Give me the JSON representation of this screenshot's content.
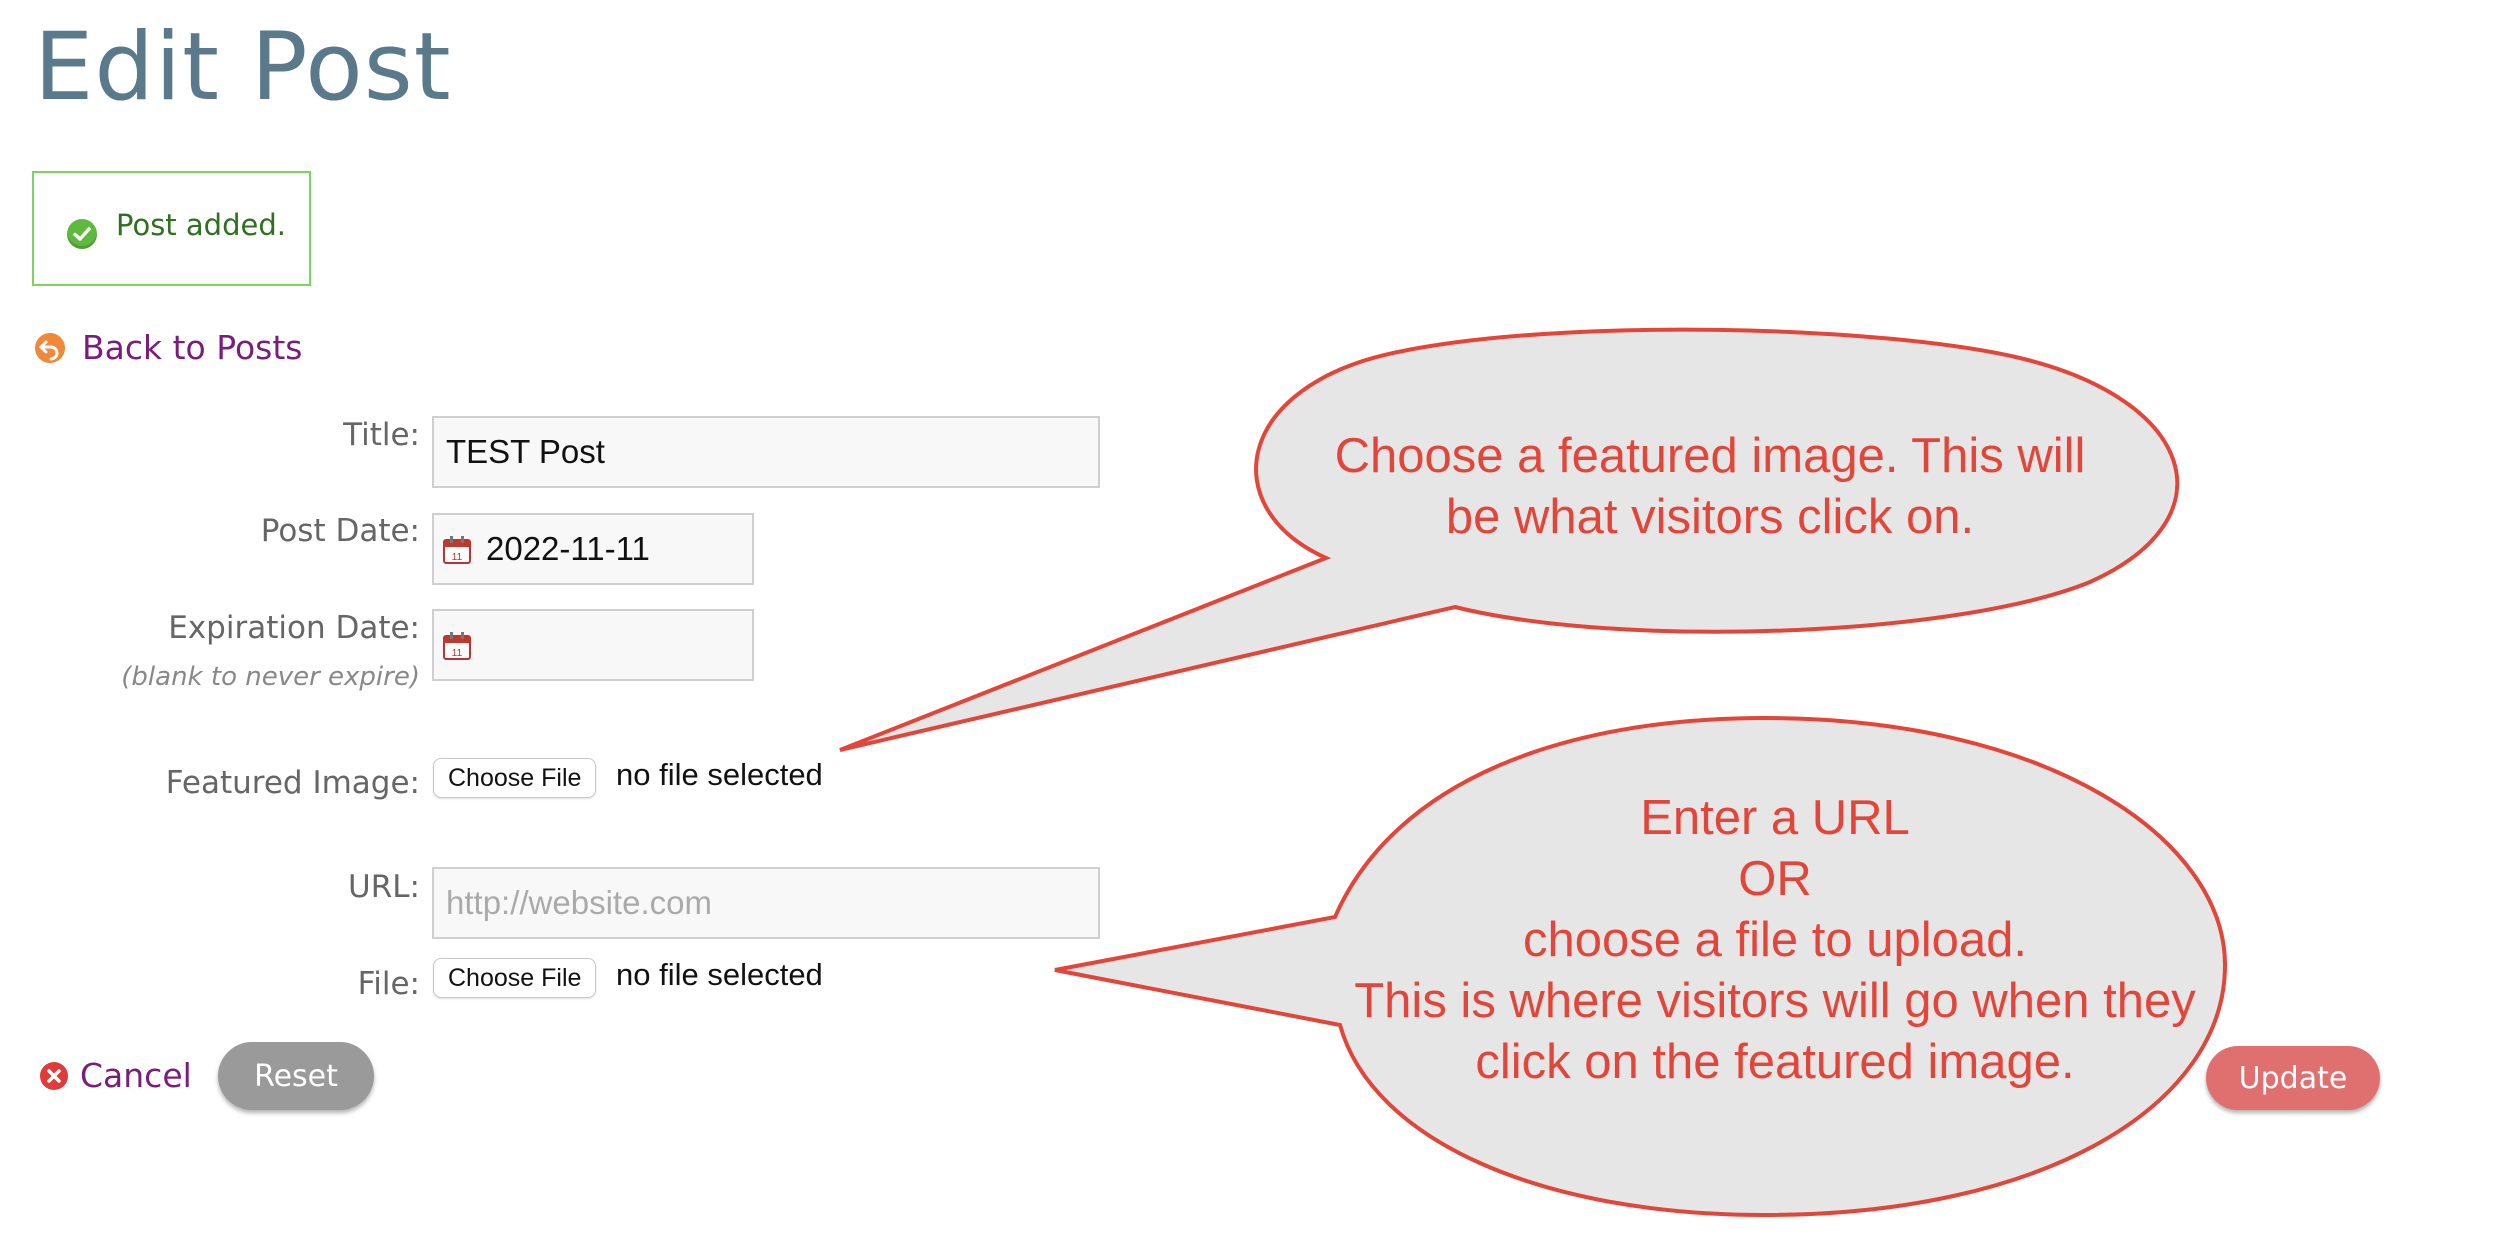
{
  "page": {
    "title": "Edit Post"
  },
  "notice": {
    "message": "Post added.",
    "icon": "check-circle-icon",
    "border_color": "#7fd35f"
  },
  "back_link": {
    "label": "Back to Posts",
    "icon": "back-arrow-icon"
  },
  "form": {
    "title": {
      "label": "Title:",
      "value": "TEST Post"
    },
    "post_date": {
      "label": "Post Date:",
      "value": "2022-11-11",
      "icon": "calendar-icon"
    },
    "expiration_date": {
      "label": "Expiration Date:",
      "hint": "(blank to never expire)",
      "value": "",
      "icon": "calendar-icon"
    },
    "featured_image": {
      "label": "Featured Image:",
      "button_label": "Choose File",
      "status": "no file selected"
    },
    "url": {
      "label": "URL:",
      "value": "",
      "placeholder": "http://website.com"
    },
    "file": {
      "label": "File:",
      "button_label": "Choose File",
      "status": "no file selected"
    }
  },
  "actions": {
    "cancel_label": "Cancel",
    "reset_label": "Reset",
    "update_label": "Update"
  },
  "callouts": {
    "featured_image": {
      "lines": [
        "Choose a featured image. This will",
        "be what visitors click on."
      ]
    },
    "url_or_file": {
      "lines": [
        "Enter a URL",
        "OR",
        "choose a file to upload.",
        "This is where visitors will go when they",
        "click on the featured image."
      ]
    },
    "fill_color": "#e6e6e6",
    "stroke_color": "#e2463a"
  },
  "colors": {
    "title": "#5a7a8c",
    "link": "#7a1d7a",
    "reset_button": "#9a9a9a",
    "update_button": "#e07070"
  }
}
